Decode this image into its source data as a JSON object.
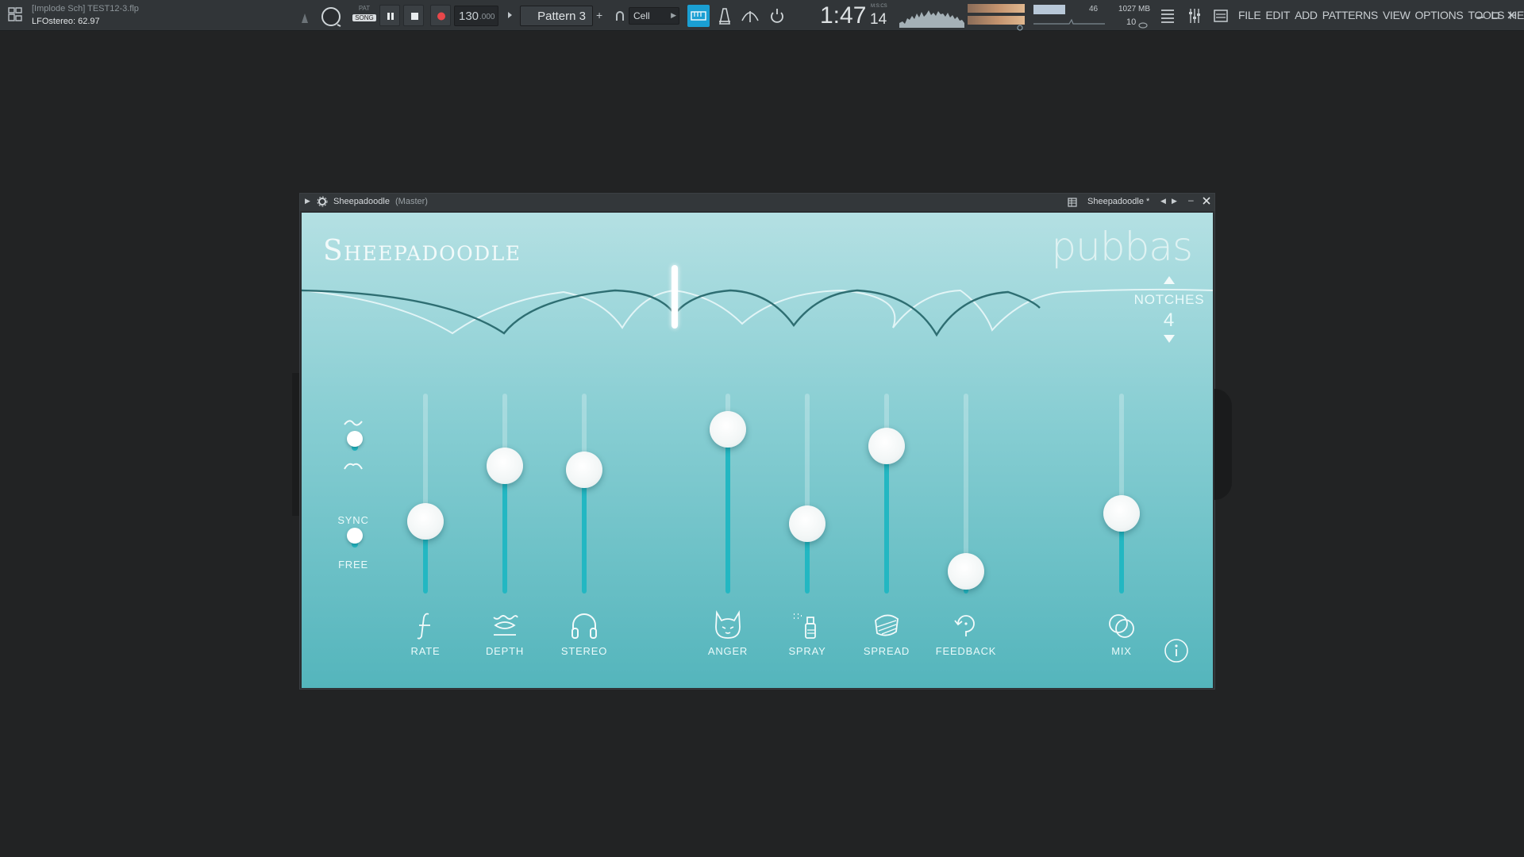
{
  "toolbar": {
    "project_line": "[Implode Sch] TEST12-3.flp",
    "hint_line": "LFOstereo: 62.97",
    "pat_label": "PAT",
    "song_label": "SONG",
    "tempo": "130",
    "tempo_decimals": ".000",
    "pattern": "Pattern 3",
    "cell_label": "Cell",
    "time_main": "1:47",
    "time_sub": "14",
    "time_unit": "M:S:CS",
    "cpu_value": "46",
    "memory": "1027 MB",
    "polyphony": "10",
    "menu": [
      "FILE",
      "EDIT",
      "ADD",
      "PATTERNS",
      "VIEW",
      "OPTIONS",
      "TOOLS",
      "HELP"
    ]
  },
  "window": {
    "title": "Sheepadoodle",
    "title_suffix": "(Master)",
    "preset": "Sheepadoodle *"
  },
  "plugin": {
    "title": "Sheepadoodle",
    "brand": "pubbas",
    "notches_label": "NOTCHES",
    "notches_value": "4",
    "sync_label": "SYNC",
    "free_label": "FREE",
    "sliders": [
      {
        "label": "RATE",
        "value": 0.36,
        "icon": "rate-icon"
      },
      {
        "label": "DEPTH",
        "value": 0.64,
        "icon": "depth-icon"
      },
      {
        "label": "STEREO",
        "value": 0.62,
        "icon": "headphones-icon"
      },
      {
        "label": "ANGER",
        "value": 0.82,
        "icon": "cat-icon"
      },
      {
        "label": "SPRAY",
        "value": 0.35,
        "icon": "spray-bottle-icon"
      },
      {
        "label": "SPREAD",
        "value": 0.74,
        "icon": "spread-icon"
      },
      {
        "label": "FEEDBACK",
        "value": 0.11,
        "icon": "feedback-icon"
      },
      {
        "label": "MIX",
        "value": 0.4,
        "icon": "mix-icon"
      }
    ],
    "colors": {
      "accent": "#23b7c2",
      "panel_top": "#b4e0e3",
      "panel_bottom": "#54b5bc",
      "curve_dark": "#2e6e72"
    }
  }
}
